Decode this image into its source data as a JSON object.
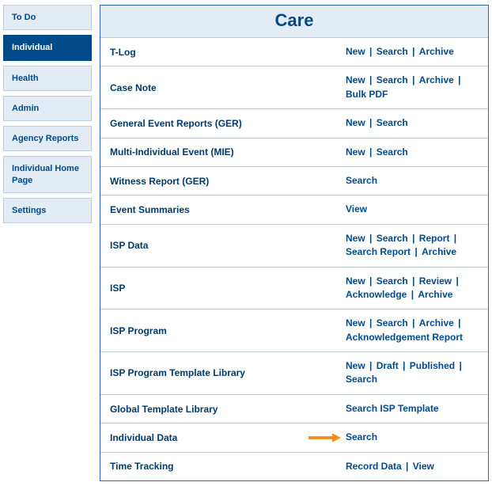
{
  "page_title": "Care",
  "sidebar": {
    "items": [
      {
        "label": "To Do",
        "active": false
      },
      {
        "label": "Individual",
        "active": true
      },
      {
        "label": "Health",
        "active": false
      },
      {
        "label": "Admin",
        "active": false
      },
      {
        "label": "Agency Reports",
        "active": false
      },
      {
        "label": "Individual Home Page",
        "active": false
      },
      {
        "label": "Settings",
        "active": false
      }
    ]
  },
  "modules": [
    {
      "name": "T-Log",
      "actions": [
        "New",
        "Search",
        "Archive"
      ],
      "arrow": false
    },
    {
      "name": "Case Note",
      "actions": [
        "New",
        "Search",
        "Archive",
        "Bulk PDF"
      ],
      "arrow": false
    },
    {
      "name": "General Event Reports (GER)",
      "actions": [
        "New",
        "Search"
      ],
      "arrow": false
    },
    {
      "name": "Multi-Individual Event (MIE)",
      "actions": [
        "New",
        "Search"
      ],
      "arrow": false
    },
    {
      "name": "Witness Report (GER)",
      "actions": [
        "Search"
      ],
      "arrow": false
    },
    {
      "name": "Event Summaries",
      "actions": [
        "View"
      ],
      "arrow": false
    },
    {
      "name": "ISP Data",
      "actions": [
        "New",
        "Search",
        "Report",
        "Search Report",
        "Archive"
      ],
      "arrow": false
    },
    {
      "name": "ISP",
      "actions": [
        "New",
        "Search",
        "Review",
        "Acknowledge",
        "Archive"
      ],
      "arrow": false
    },
    {
      "name": "ISP Program",
      "actions": [
        "New",
        "Search",
        "Archive",
        "Acknowledgement Report"
      ],
      "arrow": false
    },
    {
      "name": "ISP Program Template Library",
      "actions": [
        "New",
        "Draft",
        "Published",
        "Search"
      ],
      "arrow": false
    },
    {
      "name": "Global Template Library",
      "actions": [
        "Search ISP Template"
      ],
      "arrow": false
    },
    {
      "name": "Individual Data",
      "actions": [
        "Search"
      ],
      "arrow": true
    },
    {
      "name": "Time Tracking",
      "actions": [
        "Record Data",
        "View"
      ],
      "arrow": false
    }
  ],
  "separator": " | "
}
